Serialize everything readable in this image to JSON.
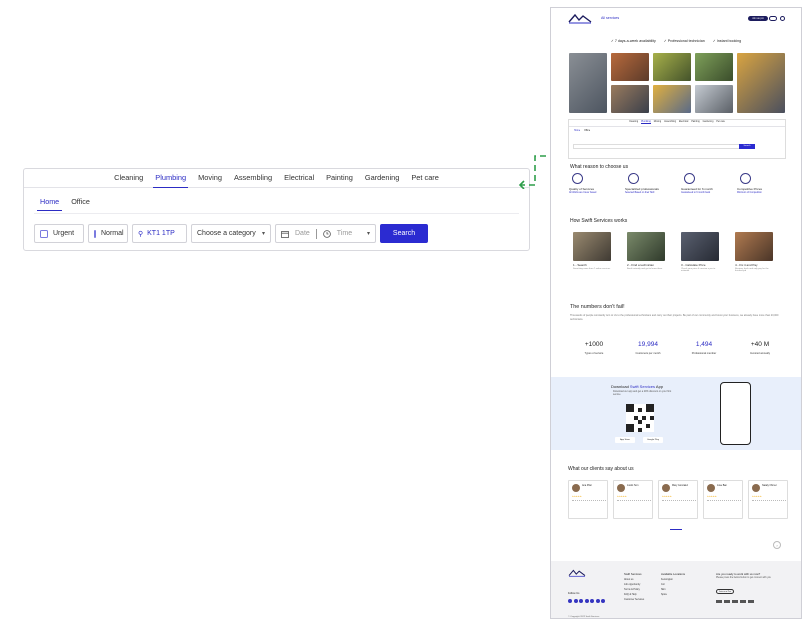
{
  "booking": {
    "service_tabs": [
      "Cleaning",
      "Plumbing",
      "Moving",
      "Assembling",
      "Electrical",
      "Painting",
      "Gardening",
      "Pet care"
    ],
    "active_service": "Plumbing",
    "property_tabs": [
      "Home",
      "Office"
    ],
    "active_property": "Home",
    "urgent_label": "Urgent",
    "normal_label": "Normal",
    "postcode_value": "KT1 1TP",
    "category_placeholder": "Choose a category",
    "date_placeholder": "Date",
    "time_placeholder": "Time",
    "search_label": "Search"
  },
  "page": {
    "header": {
      "all_services": "All services",
      "join": "Join as pro"
    },
    "badges": [
      "✓ 7 days-a-week availability",
      "✓ Professional technician",
      "✓ Instant booking"
    ],
    "reasons_title": "What reason to choose us",
    "reasons": [
      {
        "title": "Quality of Services",
        "sub": "All Works are Cover based"
      },
      {
        "title": "Specialized professionals",
        "sub": "Selected Based on their Skill"
      },
      {
        "title": "Guaranteed for 6 month",
        "sub": "Guaranteed to 6 month back"
      },
      {
        "title": "Competitive Prices",
        "sub": "Minimum of Competition"
      }
    ],
    "how_title": "How Swift Services works",
    "steps": [
      {
        "title": "1 - Search",
        "sub": "Searching more than 7 online services"
      },
      {
        "title": "2 - Find a technician",
        "sub": "Book instantly and get to know them"
      },
      {
        "title": "3 - Calculate Price",
        "sub": "Check your price & receive a pro to estimate"
      },
      {
        "title": "4 - Fix it and Pay",
        "sub": "Reviews fresh and only pay for the finished job"
      }
    ],
    "numbers_title": "The numbers don't fail!",
    "numbers_text": "Thousands of people constantly turn to Us to the professional technicians and carry out their projects. Be part of our community and boost your business, we already have more than 20,000 technicians.",
    "stats": [
      {
        "value": "+1000",
        "label": "Types of service",
        "blue": false
      },
      {
        "value": "19,994",
        "label": "Customers per month",
        "blue": true
      },
      {
        "value": "1,494",
        "label": "Professional member",
        "blue": true
      },
      {
        "value": "+40 M",
        "label": "Invoiced annually",
        "blue": false
      }
    ],
    "app": {
      "title_pre": "Download ",
      "title_brand": "Swift Services",
      "title_post": " App",
      "text": "Download our app and get a 20% discount on your first service",
      "app_store": "App Store",
      "google_play": "Google Play"
    },
    "clients_title": "What our clients say about us",
    "reviews": [
      {
        "name": "Ana Pilar",
        "stars": "★★★★★"
      },
      {
        "name": "Justin Tern",
        "stars": "★★★★★"
      },
      {
        "name": "Mary Gonzalez",
        "stars": "★★★★★"
      },
      {
        "name": "Jose Ban",
        "stars": "★★★★★"
      },
      {
        "name": "Nataly Ohmer",
        "stars": "★★★★★"
      }
    ],
    "footer": {
      "col1_title": "Swift Services",
      "col1_items": [
        "About us",
        "Job opportunity",
        "Terms & Policy",
        "FAQ & Help",
        "Customer Services"
      ],
      "col2_title": "Available Locations",
      "col2_items": [
        "Kensington",
        "Cor",
        "Slim",
        "Spice"
      ],
      "follow": "Follow Us",
      "ready_title": "Are you ready to work with us now?",
      "ready_text": "Please press the below button to get connect with you",
      "ready_btn": "Join as a Pro",
      "copyright": "© Copyright 2022 Swift Services"
    }
  },
  "colors": {
    "accent": "#2b2bd1",
    "navy": "#1c1c5e",
    "connector": "#2e9e4a",
    "app_band": "#e8effb"
  }
}
